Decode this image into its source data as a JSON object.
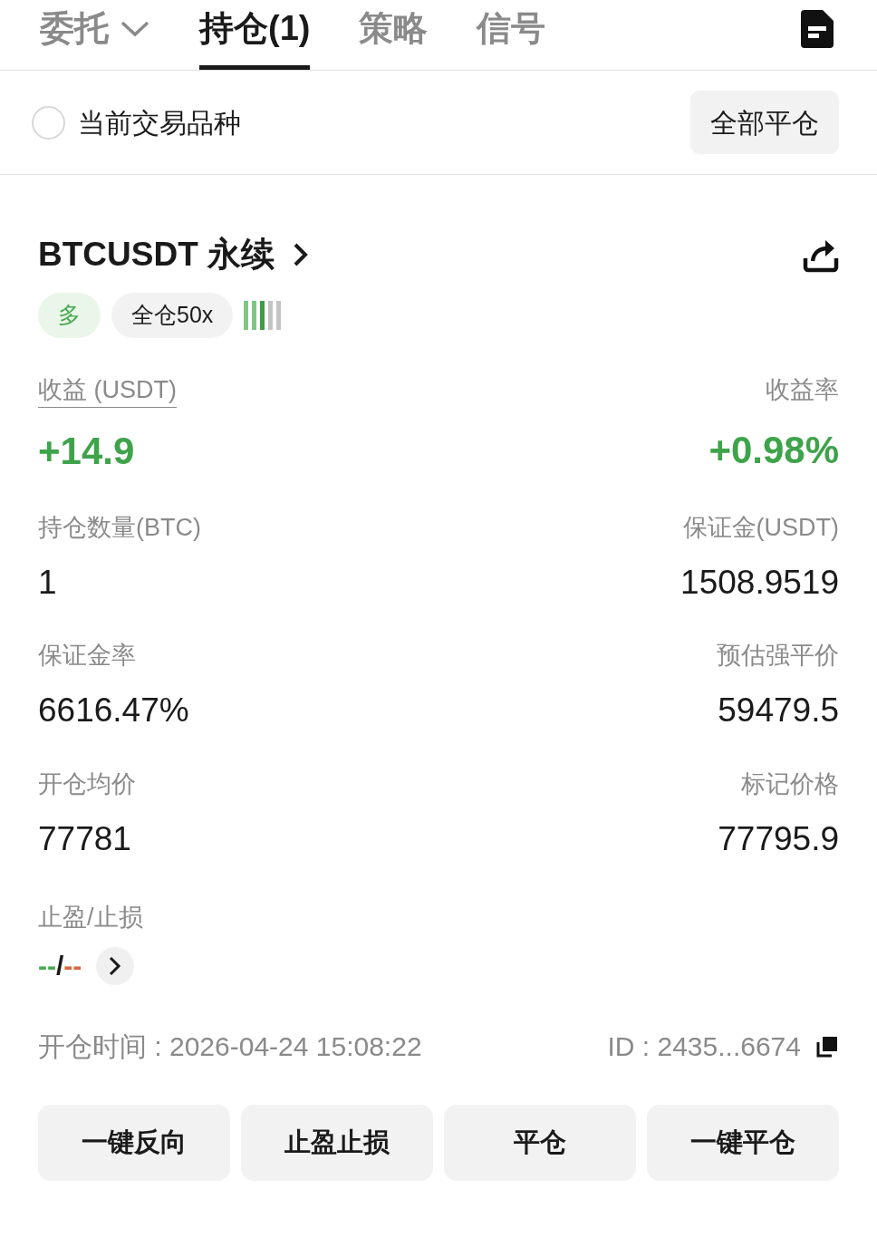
{
  "tabs": [
    {
      "label": "委托",
      "kind": "dropdown",
      "selected": false
    },
    {
      "label": "持仓(1)",
      "kind": "plain",
      "selected": true
    },
    {
      "label": "策略",
      "kind": "plain",
      "selected": false
    },
    {
      "label": "信号",
      "kind": "plain",
      "selected": false
    }
  ],
  "filter": {
    "label": "当前交易品种",
    "checked": false,
    "button": "全部平仓"
  },
  "position": {
    "symbol": "BTCUSDT 永续",
    "side": "多",
    "margin_mode": "全仓50x",
    "risk": {
      "level": 0.6
    },
    "pnl": {
      "label": "收益 (USDT)",
      "value": "+14.9"
    },
    "roi": {
      "label": "收益率",
      "value": "+0.98%"
    },
    "rows": [
      [
        {
          "label": "持仓数量(BTC)",
          "value": "1"
        },
        {
          "label": "保证金(USDT)",
          "value": "1508.9519"
        }
      ],
      [
        {
          "label": "保证金率",
          "value": "6616.47%"
        },
        {
          "label": "预估强平价",
          "value": "59479.5"
        }
      ],
      [
        {
          "label": "开仓均价",
          "value": "77781"
        },
        {
          "label": "标记价格",
          "value": "77795.9"
        }
      ]
    ],
    "tpsl": {
      "label": "止盈/止损",
      "take_profit": "--",
      "separator": "/",
      "stop_loss": "--"
    },
    "open_time": "开仓时间 : 2026-04-24 15:08:22",
    "id": "ID : 2435...6674",
    "actions": [
      "一键反向",
      "止盈止损",
      "平仓",
      "一键平仓"
    ]
  }
}
